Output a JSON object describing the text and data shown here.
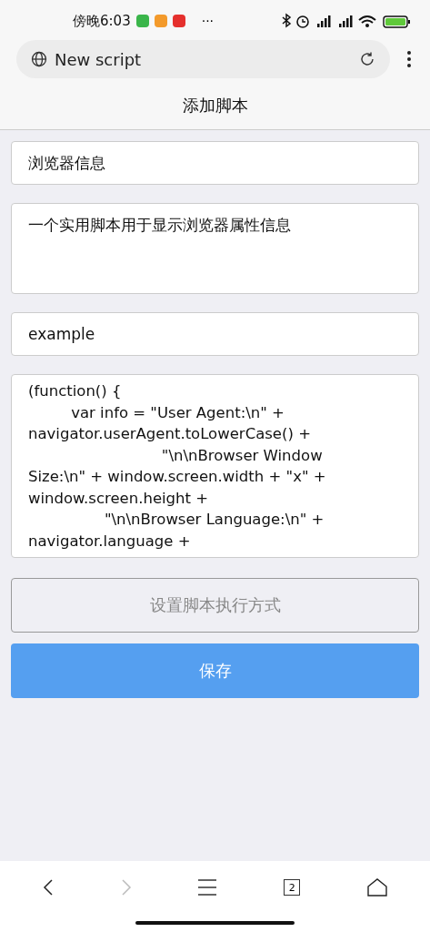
{
  "status_bar": {
    "time": "傍晚6:03",
    "more": "···"
  },
  "address_bar": {
    "title": "New script"
  },
  "page": {
    "title": "添加脚本"
  },
  "form": {
    "name": {
      "value": "浏览器信息"
    },
    "description": {
      "value": "一个实用脚本用于显示浏览器属性信息"
    },
    "author": {
      "value": "example"
    },
    "code": {
      "lines": [
        "(function() {",
        "         var info = \"User Agent:\\n\" +",
        "navigator.userAgent.toLowerCase() +",
        "                            \"\\n\\nBrowser Window",
        "Size:\\n\" + window.screen.width + \"x\" +",
        "window.screen.height +",
        "                \"\\n\\nBrowser Language:\\n\" +",
        "navigator.language +"
      ]
    },
    "buttons": [
      {
        "kind": "secondary",
        "label": "设置脚本执行方式"
      },
      {
        "kind": "primary",
        "label": "保存"
      }
    ]
  },
  "bottom_nav": {
    "back_disabled": false,
    "forward_disabled": true,
    "tab_count": "2"
  }
}
